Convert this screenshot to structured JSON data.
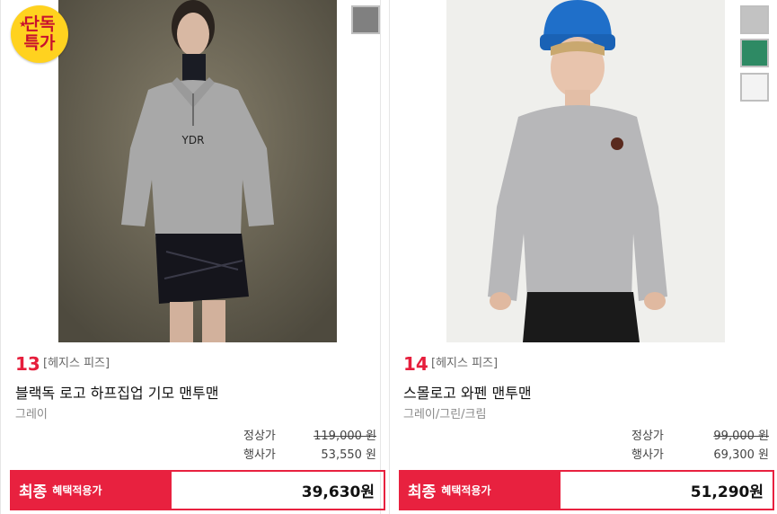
{
  "products": [
    {
      "rank": "13",
      "brand": "[헤지스 피즈]",
      "name": "블랙독 로고 하프집업 기모 맨투맨",
      "colors": "그레이",
      "badge_line1": "단독",
      "badge_line2": "특가",
      "swatches": [
        "#808080"
      ],
      "regular_label": "정상가",
      "regular_price": "119,000 원",
      "sale_label": "행사가",
      "sale_price": "53,550 원",
      "final_label": "최종",
      "final_sub": "혜택적용가",
      "final_price": "39,630원"
    },
    {
      "rank": "14",
      "brand": "[헤지스 피즈]",
      "name": "스몰로고 와펜 맨투맨",
      "colors": "그레이/그린/크림",
      "swatches": [
        "#c2c2c2",
        "#2e8a64",
        "#f3f3f3"
      ],
      "regular_label": "정상가",
      "regular_price": "99,000 원",
      "sale_label": "행사가",
      "sale_price": "69,300 원",
      "final_label": "최종",
      "final_sub": "혜택적용가",
      "final_price": "51,290원"
    }
  ]
}
